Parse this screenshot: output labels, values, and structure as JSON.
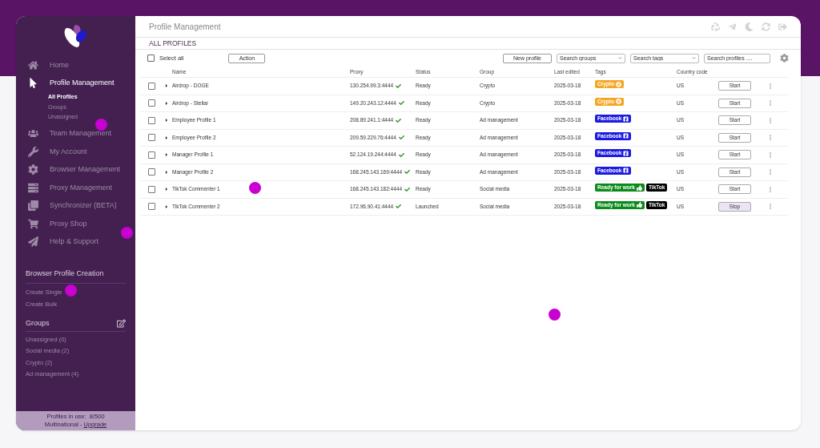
{
  "sidebar": {
    "nav": [
      {
        "label": "Home",
        "kind": "home",
        "selected": false
      },
      {
        "label": "Profile Management",
        "kind": "pointer",
        "selected": true,
        "children": [
          {
            "label": "All Profiles",
            "selected": true
          },
          {
            "label": "Groups",
            "selected": false
          },
          {
            "label": "Unassigned",
            "selected": false
          }
        ]
      },
      {
        "label": "Team Management",
        "kind": "users",
        "selected": false
      },
      {
        "label": "My Account",
        "kind": "wrench",
        "selected": false
      },
      {
        "label": "Browser Management",
        "kind": "gear",
        "selected": false
      },
      {
        "label": "Proxy Management",
        "kind": "server",
        "selected": false
      },
      {
        "label": "Synchronizer (BETA)",
        "kind": "copy",
        "selected": false
      },
      {
        "label": "Proxy Shop",
        "kind": "cart",
        "selected": false
      },
      {
        "label": "Help & Support",
        "kind": "send",
        "selected": false
      }
    ],
    "creation": {
      "title": "Browser Profile Creation",
      "items": [
        "Create Single",
        "Create Bulk"
      ]
    },
    "groups": {
      "title": "Groups",
      "items": [
        "Unassigned (0)",
        "Social media (2)",
        "Crypto (2)",
        "Ad management (4)"
      ]
    },
    "footer": {
      "usage": "Profiles in use:  8/500",
      "plan": "Multinational - ",
      "upgrade": "Upgrade"
    }
  },
  "header": {
    "title": "Profile Management"
  },
  "section_title": "ALL PROFILES",
  "toolbar": {
    "select_all": {
      "label": "Select all",
      "checked": false
    },
    "action": "Action",
    "new_profile": "New profile",
    "search_groups": {
      "placeholder": "Search groups"
    },
    "search_tags": {
      "placeholder": "Search tags"
    },
    "search_profiles": {
      "placeholder": "Search profiles ...."
    }
  },
  "table": {
    "columns": [
      "Name",
      "Proxy",
      "Status",
      "Group",
      "Last edited",
      "Tags",
      "Country code"
    ],
    "rows": [
      {
        "checked": false,
        "name": "Airdrop - DOGE",
        "proxy": "130.254.99.3:4444",
        "status": "Ready",
        "group": "Crypto",
        "edited": "2025-03-18",
        "tags": [
          {
            "label": "Crypto",
            "kind": "bitcoin",
            "color": "#f5a623"
          }
        ],
        "country": "US",
        "button": {
          "label": "Start",
          "active": false
        }
      },
      {
        "checked": false,
        "name": "Airdrop - Stellar",
        "proxy": "149.20.243.12:4444",
        "status": "Ready",
        "group": "Crypto",
        "edited": "2025-03-18",
        "tags": [
          {
            "label": "Crypto",
            "kind": "bitcoin",
            "color": "#f5a623"
          }
        ],
        "country": "US",
        "button": {
          "label": "Start",
          "active": false
        }
      },
      {
        "checked": false,
        "name": "Employee Profile 1",
        "proxy": "208.89.241.1:4444",
        "status": "Ready",
        "group": "Ad management",
        "edited": "2025-03-18",
        "tags": [
          {
            "label": "Facebook",
            "kind": "facebook",
            "color": "#1a1ae0"
          }
        ],
        "country": "US",
        "button": {
          "label": "Start",
          "active": false
        }
      },
      {
        "checked": false,
        "name": "Employee Profile 2",
        "proxy": "209.59.229.76:4444",
        "status": "Ready",
        "group": "Ad management",
        "edited": "2025-03-18",
        "tags": [
          {
            "label": "Facebook",
            "kind": "facebook",
            "color": "#1a1ae0"
          }
        ],
        "country": "US",
        "button": {
          "label": "Start",
          "active": false
        }
      },
      {
        "checked": false,
        "name": "Manager Profile 1",
        "proxy": "52.124.19.244:4444",
        "status": "Ready",
        "group": "Ad management",
        "edited": "2025-03-18",
        "tags": [
          {
            "label": "Facebook",
            "kind": "facebook",
            "color": "#1a1ae0"
          }
        ],
        "country": "US",
        "button": {
          "label": "Start",
          "active": false
        }
      },
      {
        "checked": false,
        "name": "Manager Profile 2",
        "proxy": "168.245.143.169:4444",
        "status": "Ready",
        "group": "Ad management",
        "edited": "2025-03-18",
        "tags": [
          {
            "label": "Facebook",
            "kind": "facebook",
            "color": "#1a1ae0"
          }
        ],
        "country": "US",
        "button": {
          "label": "Start",
          "active": false
        }
      },
      {
        "checked": false,
        "name": "TikTok Commenter 1",
        "proxy": "168.245.143.182:4444",
        "status": "Ready",
        "group": "Social media",
        "edited": "2025-03-18",
        "tags": [
          {
            "label": "Ready for work",
            "kind": "thumb",
            "color": "#0a8a1a"
          },
          {
            "label": "TikTok",
            "kind": "none",
            "color": "#000000"
          }
        ],
        "country": "US",
        "button": {
          "label": "Start",
          "active": false
        }
      },
      {
        "checked": false,
        "name": "TikTok Commenter 2",
        "proxy": "172.96.90.41:4444",
        "status": "Launched",
        "group": "Social media",
        "edited": "2025-03-18",
        "tags": [
          {
            "label": "Ready for work",
            "kind": "thumb",
            "color": "#0a8a1a"
          },
          {
            "label": "TikTok",
            "kind": "none",
            "color": "#000000"
          }
        ],
        "country": "US",
        "button": {
          "label": "Stop",
          "active": true
        }
      }
    ]
  }
}
